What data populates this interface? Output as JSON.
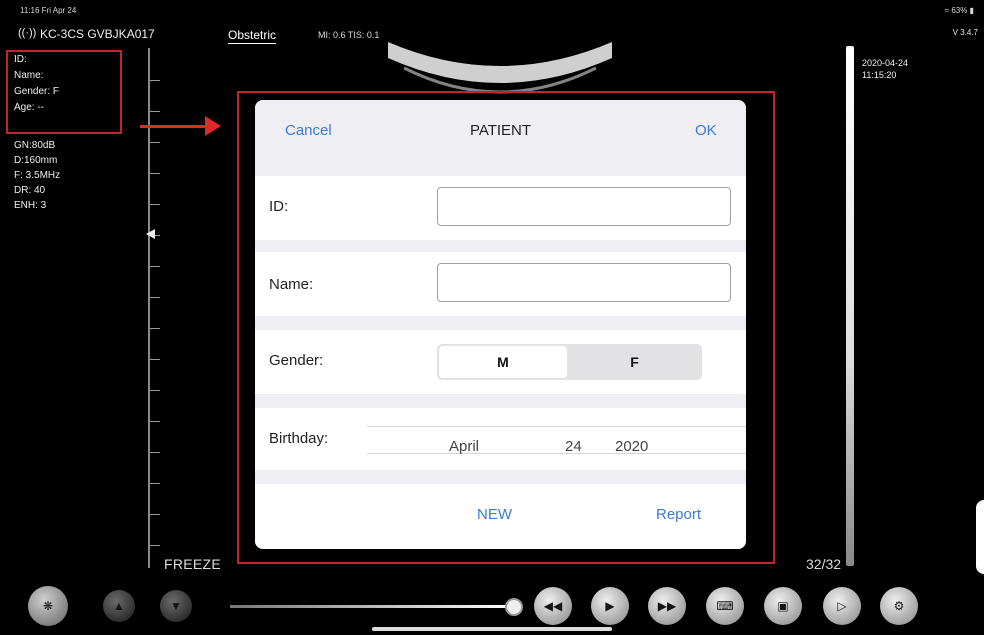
{
  "status_bar": {
    "time": "11:16  Fri Apr 24",
    "battery": "63%",
    "version": "V 3.4.7"
  },
  "header": {
    "probe": "KC-3CS GVBJKA017",
    "mode": "Obstetric",
    "mi_tis": "MI: 0.6  TIS: 0.1"
  },
  "patient_info": {
    "id": "ID:",
    "name": "Name:",
    "gender": "Gender: F",
    "age": "Age: --"
  },
  "params": [
    "GN:80dB",
    "D:160mm",
    "F: 3.5MHz",
    "DR: 40",
    "ENH: 3"
  ],
  "datetime": {
    "date": "2020-04-24",
    "time": "11:15:20"
  },
  "dialog": {
    "cancel": "Cancel",
    "title": "PATIENT",
    "ok": "OK",
    "id_label": "ID:",
    "id_value": "",
    "name_label": "Name:",
    "name_value": "",
    "gender_label": "Gender:",
    "gender_options": [
      "M",
      "F"
    ],
    "gender_selected": "M",
    "birthday_label": "Birthday:",
    "birthday": {
      "month": "April",
      "day": "24",
      "year": "2020"
    },
    "new": "NEW",
    "report": "Report"
  },
  "freeze": "FREEZE",
  "frames": "32/32",
  "toolbar_icons": [
    "probe-select-icon",
    "arrow-up-icon",
    "arrow-down-icon",
    "rewind-icon",
    "play-icon",
    "fast-forward-icon",
    "keyboard-icon",
    "save-icon",
    "video-icon",
    "settings-icon"
  ],
  "colors": {
    "accent": "#3b7bd0",
    "highlight": "#c0262a",
    "arrow": "#e02a2a"
  }
}
